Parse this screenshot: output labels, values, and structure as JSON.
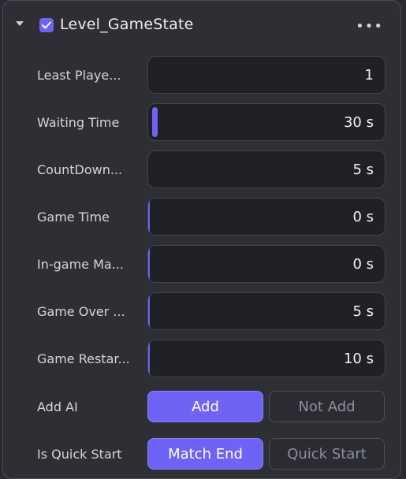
{
  "component": {
    "title": "Level_GameState",
    "enabled": true,
    "menu_glyph": "•••"
  },
  "fields": [
    {
      "label": "Least Playe...",
      "value": "1",
      "fill": 0
    },
    {
      "label": "Waiting Time",
      "value": "30 s",
      "fill": 0.03
    },
    {
      "label": "CountDown...",
      "value": "5 s",
      "fill": 0
    },
    {
      "label": "Game Time",
      "value": "0 s",
      "fill": 0.005
    },
    {
      "label": "In-game Ma...",
      "value": "0 s",
      "fill": 0.005
    },
    {
      "label": "Game Over ...",
      "value": "5 s",
      "fill": 0.005
    },
    {
      "label": "Game Restar...",
      "value": "10 s",
      "fill": 0.005
    }
  ],
  "toggles": [
    {
      "label": "Add AI",
      "options": [
        "Add",
        "Not Add"
      ],
      "selected": 0
    },
    {
      "label": "Is Quick Start",
      "options": [
        "Match End",
        "Quick Start"
      ],
      "selected": 0
    }
  ],
  "colors": {
    "accent": "#6e63f5"
  }
}
